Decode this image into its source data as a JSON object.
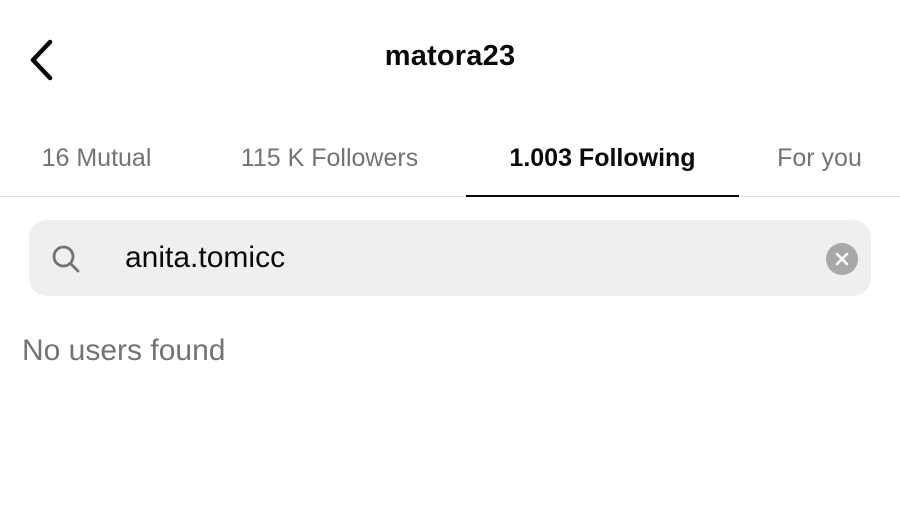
{
  "header": {
    "title": "matora23",
    "back_icon": "chevron-left-icon"
  },
  "tabs": [
    {
      "label": "16 Mutual",
      "active": false
    },
    {
      "label": "115 K Followers",
      "active": false
    },
    {
      "label": "1.003 Following",
      "active": true
    },
    {
      "label": "For you",
      "active": false
    }
  ],
  "search": {
    "value": "anita.tomicc",
    "icon": "search-icon",
    "clear_icon": "clear-icon"
  },
  "results": {
    "empty_message": "No users found"
  },
  "colors": {
    "text_primary": "#0a0a0a",
    "text_secondary": "#737373",
    "search_background": "#efefef",
    "clear_button": "#a8a8a8",
    "divider": "#e2e2e2"
  }
}
